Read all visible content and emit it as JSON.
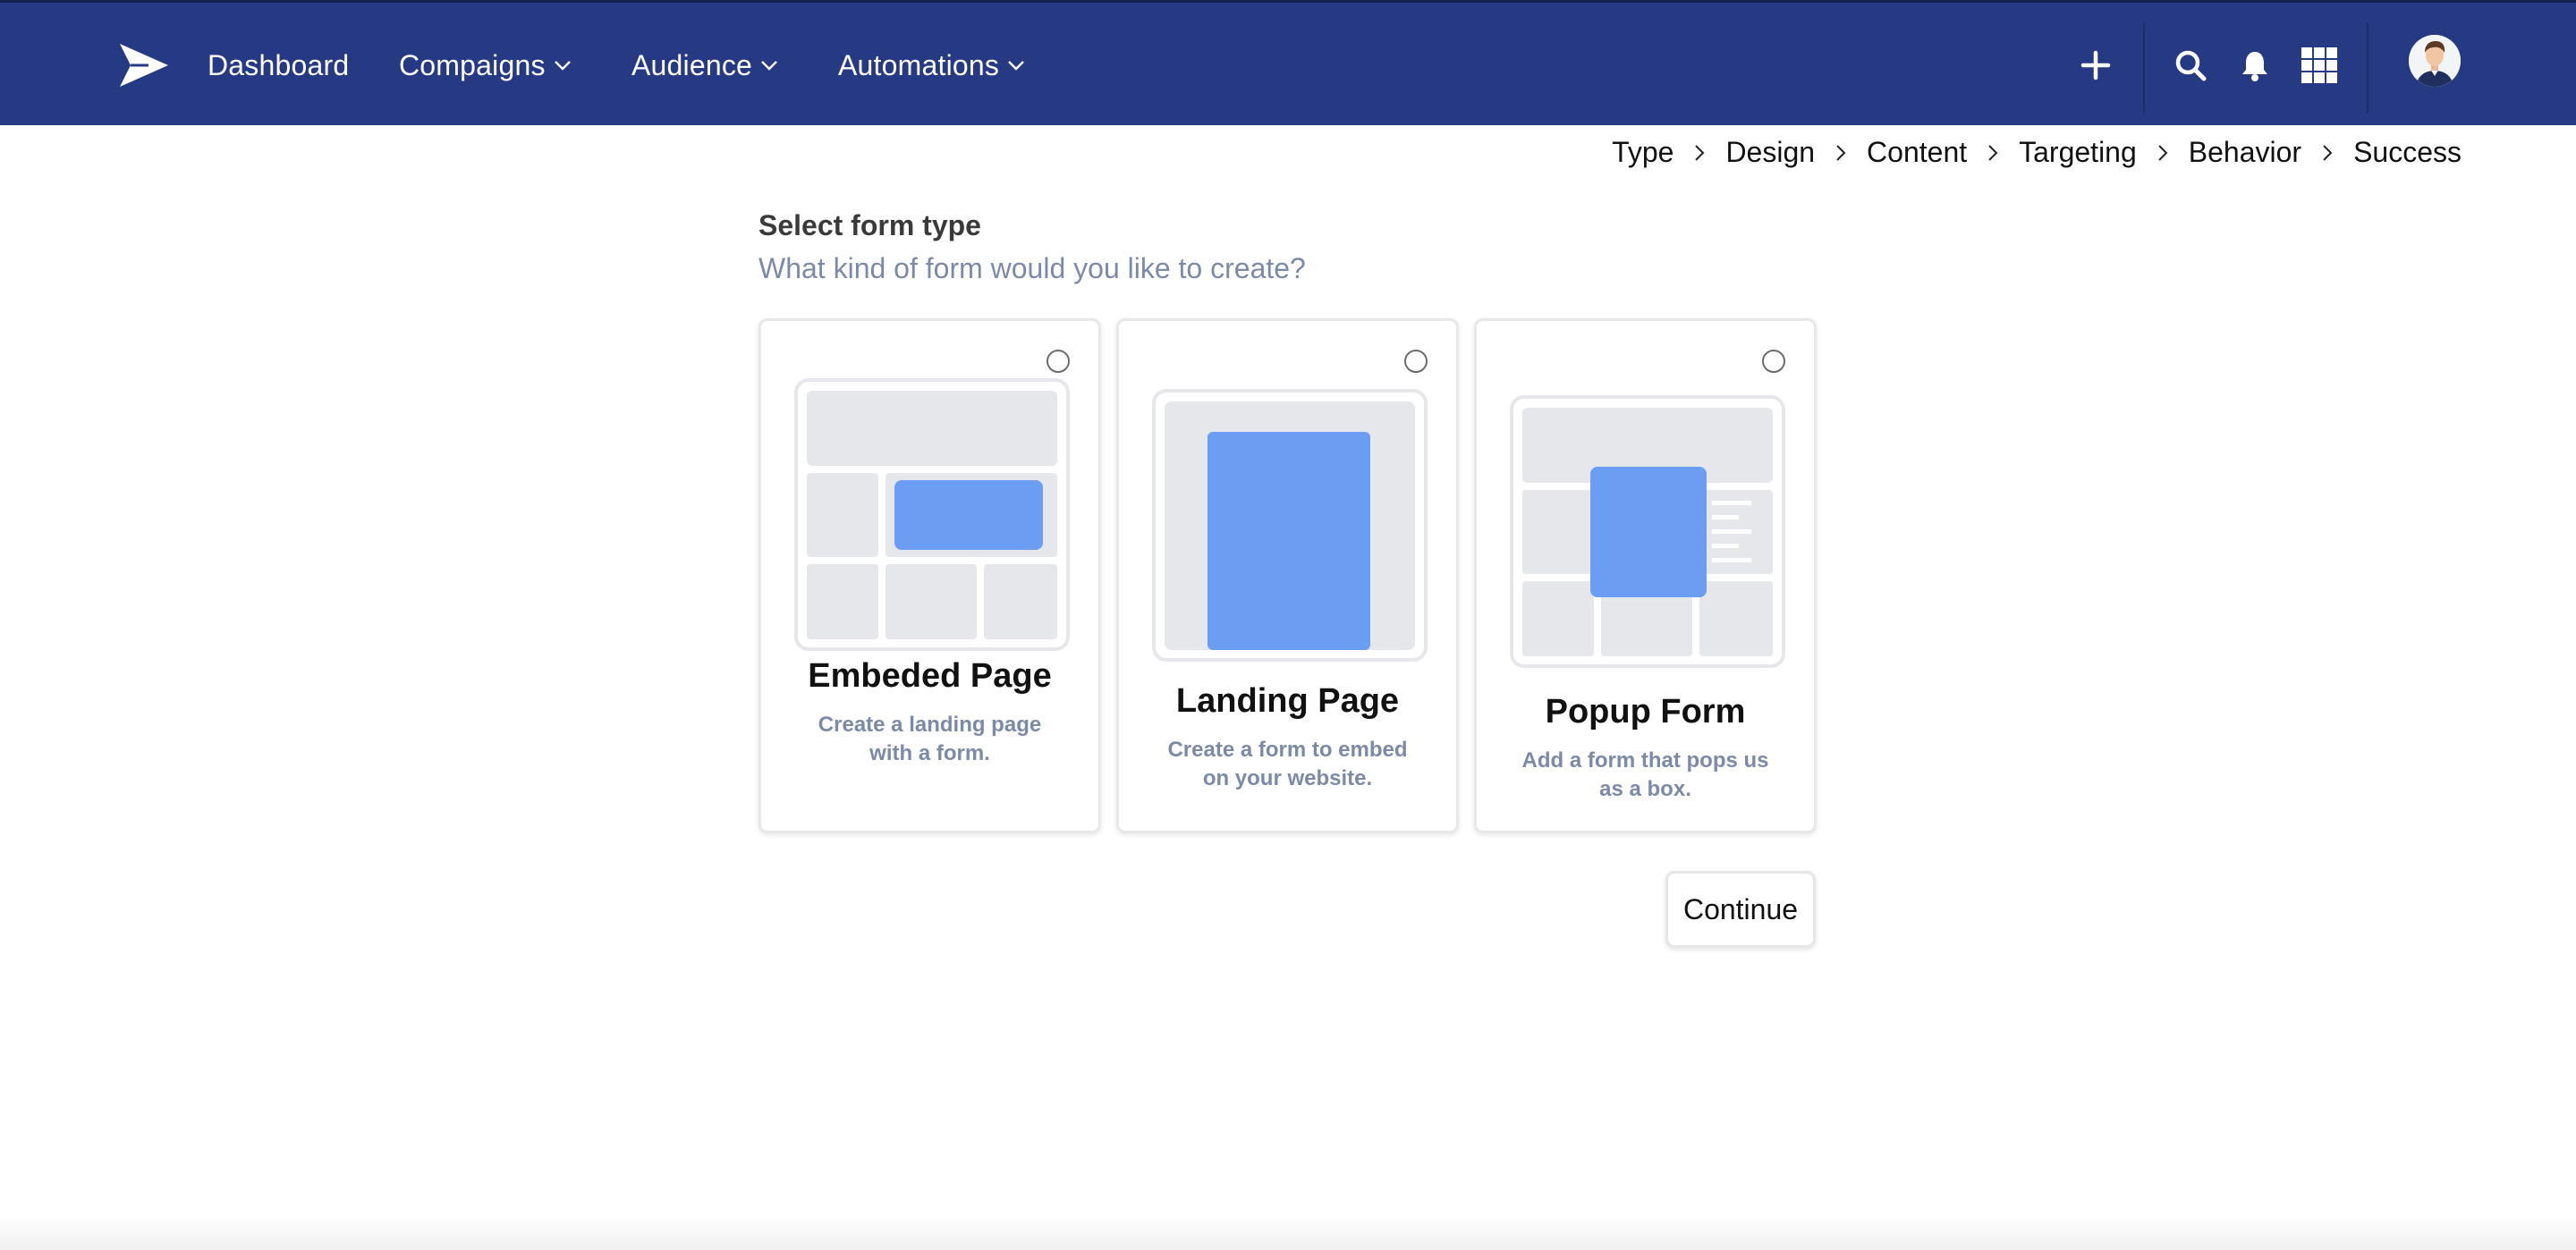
{
  "nav": {
    "logo_icon": "paper-plane-logo-icon",
    "items": [
      {
        "label": "Dashboard"
      },
      {
        "label": "Compaigns"
      },
      {
        "label": "Audience"
      },
      {
        "label": "Automations"
      }
    ],
    "actions": [
      "plus-icon",
      "search-icon",
      "bell-icon",
      "apps-grid-icon"
    ],
    "avatar_icon": "user-avatar",
    "colors": {
      "bar": "#263a84",
      "text": "#ffffff"
    }
  },
  "breadcrumb": {
    "steps": [
      "Type",
      "Design",
      "Content",
      "Targeting",
      "Behavior",
      "Success"
    ]
  },
  "heading": {
    "title": "Select form type",
    "subtitle": "What kind of form would you like to create?"
  },
  "cards": [
    {
      "title": "Embeded Page",
      "description": "Create a landing page with a form.",
      "selected": false
    },
    {
      "title": "Landing Page",
      "description": "Create a form to embed on your website.",
      "selected": false
    },
    {
      "title": "Popup Form",
      "description": "Add a form that pops us as a box.",
      "selected": false
    }
  ],
  "illustration_colors": {
    "frame": "#e5e7eb",
    "accent": "#6b9ef3"
  },
  "actions": {
    "continue_label": "Continue"
  }
}
